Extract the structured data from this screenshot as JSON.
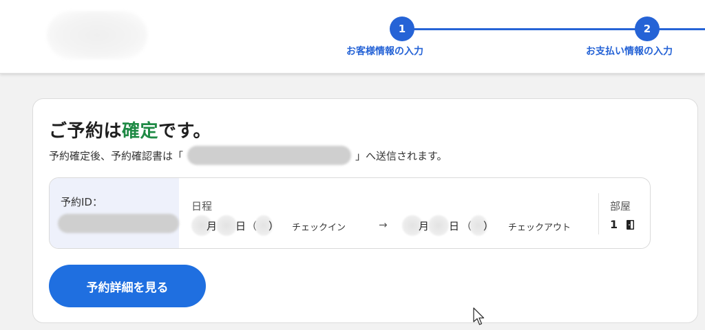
{
  "header": {
    "steps": [
      {
        "number": "1",
        "label": "お客様情報の入力"
      },
      {
        "number": "2",
        "label": "お支払い情報の入力"
      }
    ]
  },
  "confirmation": {
    "title_prefix": "ご予約は",
    "title_highlight": "確定",
    "title_suffix": "です。",
    "subtitle_before": "予約確定後、予約確認書は「",
    "subtitle_after": "」へ送信されます。",
    "reservation_id_label": "予約ID：",
    "schedule_label": "日程",
    "checkin": {
      "month_unit": "月",
      "day_unit": "日",
      "paren_open": "（",
      "paren_close": "）",
      "label": "チェックイン"
    },
    "arrow": "→",
    "checkout": {
      "month_unit": "月",
      "day_unit": "日",
      "paren_open": "（",
      "paren_close": "）",
      "label": "チェックアウト"
    },
    "room_label": "部屋",
    "room_count": "1",
    "detail_button": "予約詳細を見る"
  },
  "colors": {
    "accent_blue": "#2563d6",
    "button_blue": "#1f6fe0",
    "confirm_green": "#1f8a45"
  },
  "icons": [
    "room-icon",
    "mouse-cursor-icon"
  ]
}
